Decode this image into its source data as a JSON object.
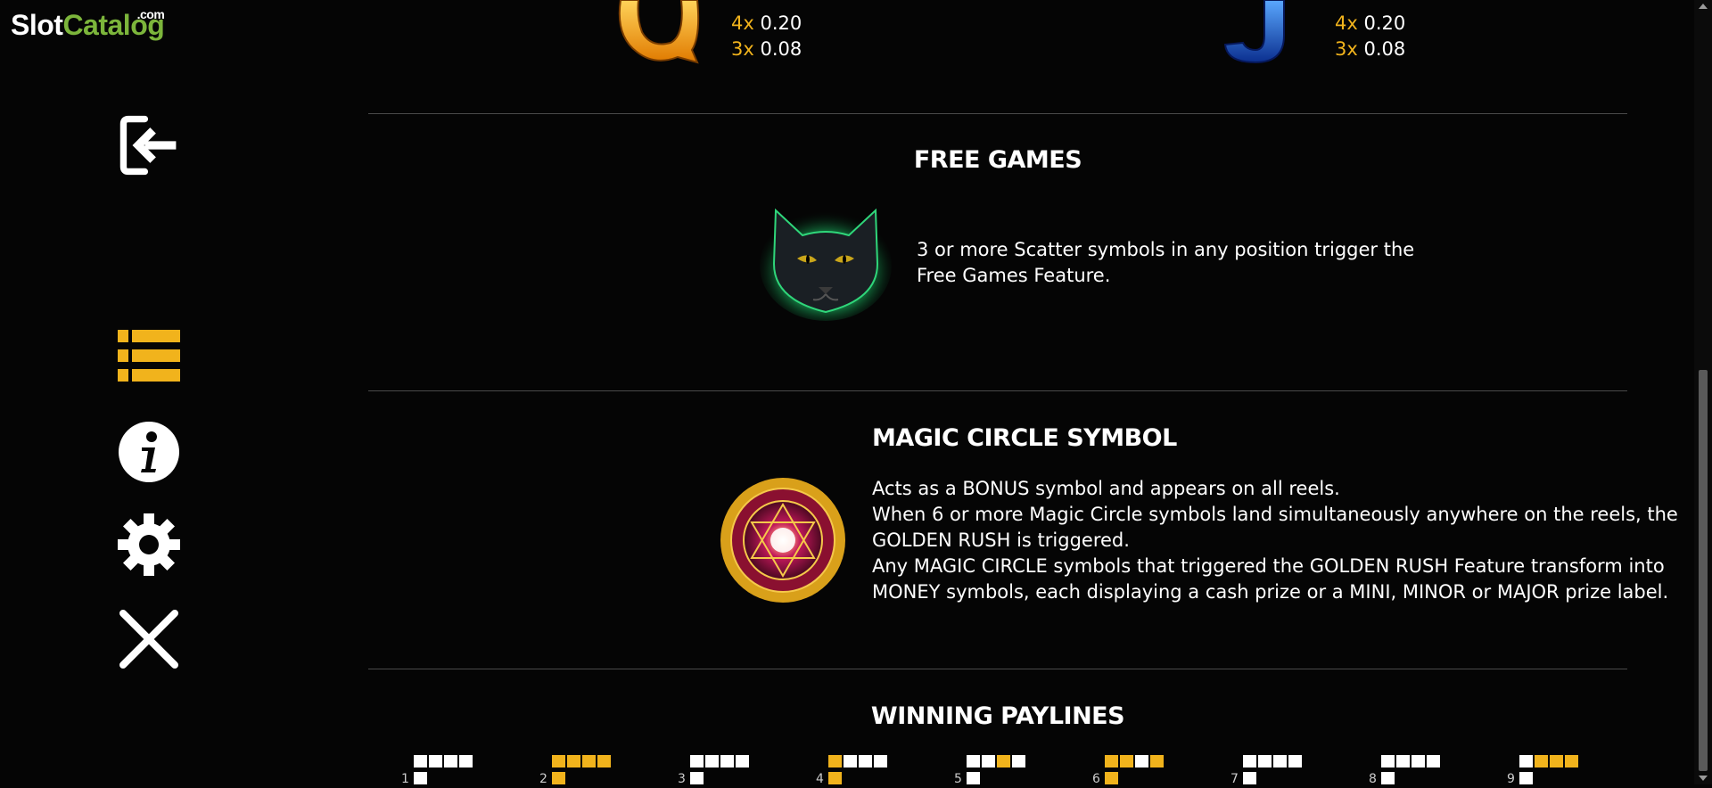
{
  "brand": {
    "part1": "Slot",
    "part2": "Catalog",
    "suffix": ".com"
  },
  "sidebar": {
    "icons": [
      "exit-icon",
      "paytable-list-icon",
      "info-icon",
      "gear-icon",
      "close-icon"
    ]
  },
  "paytable_top": {
    "left": {
      "symbol": "Q",
      "rows": [
        {
          "mult": "4x",
          "value": "0.20"
        },
        {
          "mult": "3x",
          "value": "0.08"
        }
      ]
    },
    "right": {
      "symbol": "J",
      "rows": [
        {
          "mult": "4x",
          "value": "0.20"
        },
        {
          "mult": "3x",
          "value": "0.08"
        }
      ]
    }
  },
  "free_games": {
    "title": "FREE GAMES",
    "text": [
      "3 or more Scatter symbols in any position trigger the",
      "Free Games Feature."
    ]
  },
  "magic_circle": {
    "title": "MAGIC CIRCLE SYMBOL",
    "text": [
      "Acts as a BONUS symbol and appears on all reels.",
      "When 6 or more Magic Circle symbols land simultaneously anywhere on the reels, the",
      "GOLDEN RUSH is triggered.",
      "Any MAGIC CIRCLE symbols that triggered the GOLDEN RUSH Feature transform into",
      "MONEY symbols, each displaying a cash prize or a MINI, MINOR or MAJOR prize label."
    ]
  },
  "paylines": {
    "title": "WINNING PAYLINES",
    "items": [
      {
        "num": "1",
        "top": [
          0,
          0,
          0,
          0,
          0
        ]
      },
      {
        "num": "2",
        "top": [
          1,
          1,
          1,
          1,
          1
        ]
      },
      {
        "num": "3",
        "top": [
          0,
          0,
          0,
          0,
          0
        ]
      },
      {
        "num": "4",
        "top": [
          1,
          0,
          0,
          0,
          1
        ]
      },
      {
        "num": "5",
        "top": [
          0,
          0,
          1,
          0,
          0
        ]
      },
      {
        "num": "6",
        "top": [
          1,
          1,
          0,
          1,
          1
        ]
      },
      {
        "num": "7",
        "top": [
          0,
          0,
          0,
          0,
          0
        ]
      },
      {
        "num": "8",
        "top": [
          0,
          0,
          0,
          0,
          0
        ]
      },
      {
        "num": "9",
        "top": [
          0,
          1,
          1,
          1,
          0
        ]
      }
    ]
  },
  "colors": {
    "accent": "#f1b31c",
    "brand_green": "#7cb53b",
    "background": "#050505"
  }
}
